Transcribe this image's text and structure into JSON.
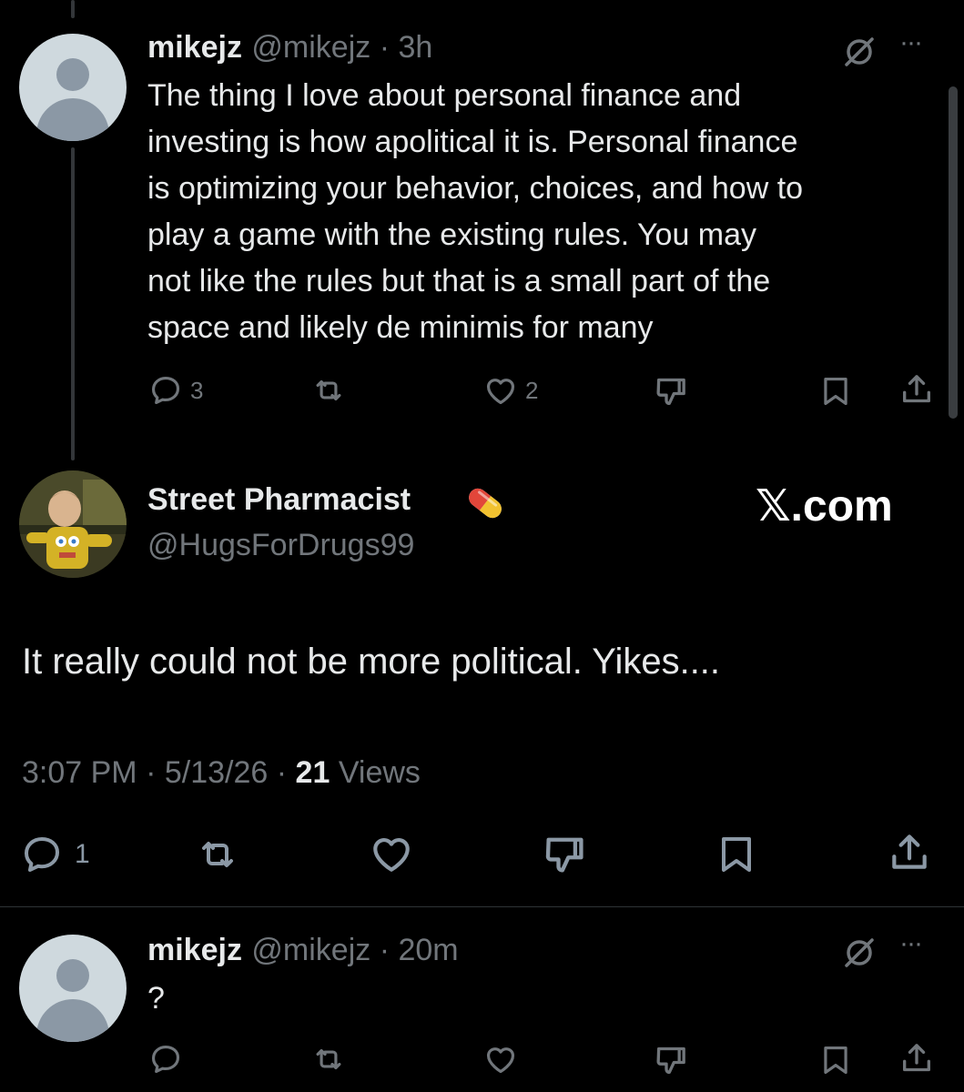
{
  "tweet1": {
    "display_name": "mikejz",
    "handle_time": "@mikejz · 3h",
    "text_lines": [
      "The thing I love about personal finance and",
      "investing is how apolitical it is.  Personal finance",
      "is optimizing your behavior, choices, and how to",
      "play a game with the existing rules.   You may",
      "not like the rules but that is a small part of the",
      "space and likely de minimis for many"
    ],
    "reply_count": "3",
    "like_count": "2",
    "more_glyph": "···"
  },
  "main_tweet": {
    "display_name": "Street Pharmacist",
    "handle": "@HugsForDrugs99",
    "text": "It really could not be more political. Yikes....",
    "time": "3:07 PM",
    "dot1": "·",
    "date": "5/13/26",
    "dot2": "·",
    "views_count": "21",
    "views_label": "Views",
    "reply_count": "1",
    "pill_emoji": "💊"
  },
  "watermark": {
    "text": "𝕏.com"
  },
  "tweet3": {
    "display_name": "mikejz",
    "handle_time": "@mikejz · 20m",
    "text": "?",
    "more_glyph": "···"
  },
  "icons": {
    "reply": "reply-icon",
    "retweet": "retweet-icon",
    "like": "heart-icon",
    "dislike": "thumbs-down-icon",
    "bookmark": "bookmark-icon",
    "share": "share-icon",
    "grok": "grok-icon",
    "more": "more-icon"
  },
  "colors": {
    "background": "#000000",
    "text": "#e7e9ea",
    "secondary": "#71767b",
    "divider": "#2f3336"
  }
}
